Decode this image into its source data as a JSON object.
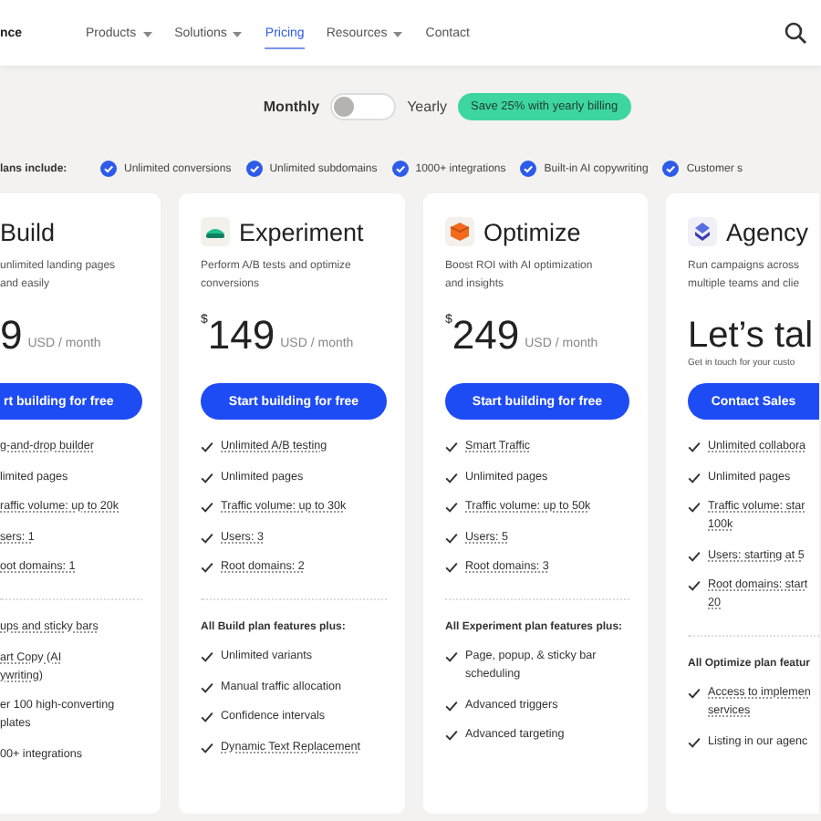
{
  "nav": {
    "logo": "nce",
    "items": [
      {
        "label": "Products",
        "dropdown": true,
        "selected": false
      },
      {
        "label": "Solutions",
        "dropdown": true,
        "selected": false
      },
      {
        "label": "Pricing",
        "dropdown": false,
        "selected": true
      },
      {
        "label": "Resources",
        "dropdown": true,
        "selected": false
      },
      {
        "label": "Contact",
        "dropdown": false,
        "selected": false
      }
    ]
  },
  "billing": {
    "monthly": "Monthly",
    "yearly": "Yearly",
    "yearly_on": false,
    "badge": "Save 25% with yearly billing"
  },
  "includes": {
    "label": "lans include:",
    "items": [
      "Unlimited conversions",
      "Unlimited subdomains",
      "1000+ integrations",
      "Built-in AI copywriting",
      "Customer s"
    ]
  },
  "plans": [
    {
      "clipped": true,
      "name": "Build",
      "description_lines": [
        "unlimited landing pages",
        "and easily"
      ],
      "price": "9",
      "period": "USD / month",
      "button": "rt building for free",
      "features": [
        {
          "lines": [
            "g-and-drop builder"
          ],
          "tooltip": true
        },
        {
          "lines": [
            "limited pages"
          ],
          "tooltip": false
        },
        {
          "lines": [
            "raffic volume: up to 20k"
          ],
          "tooltip": true
        },
        {
          "lines": [
            "sers: 1"
          ],
          "tooltip": true
        },
        {
          "lines": [
            "oot domains: 1"
          ],
          "tooltip": true
        }
      ],
      "extras": [
        {
          "lines": [
            "ups and sticky bars"
          ],
          "tooltip": true
        },
        {
          "lines": [
            "art Copy (AI",
            "ywriting)"
          ],
          "tooltip": true
        },
        {
          "lines": [
            "er 100 high-converting",
            "plates"
          ],
          "tooltip": false
        },
        {
          "lines": [
            "00+ integrations"
          ],
          "tooltip": false
        }
      ]
    },
    {
      "clipped": false,
      "name": "Experiment",
      "description_lines": [
        "Perform A/B tests and optimize",
        "conversions"
      ],
      "currency": "$",
      "price": "149",
      "period": "USD / month",
      "button": "Start building for free",
      "features": [
        {
          "lines": [
            "Unlimited A/B testing"
          ],
          "tooltip": true
        },
        {
          "lines": [
            "Unlimited pages"
          ],
          "tooltip": false
        },
        {
          "lines": [
            "Traffic volume: up to 30k"
          ],
          "tooltip": true
        },
        {
          "lines": [
            "Users: 3"
          ],
          "tooltip": true
        },
        {
          "lines": [
            "Root domains: 2"
          ],
          "tooltip": true
        }
      ],
      "extra_title": "All Build plan features plus:",
      "extras": [
        {
          "lines": [
            "Unlimited variants"
          ],
          "tooltip": false
        },
        {
          "lines": [
            "Manual traffic allocation"
          ],
          "tooltip": false
        },
        {
          "lines": [
            "Confidence intervals"
          ],
          "tooltip": false
        },
        {
          "lines": [
            "Dynamic Text Replacement"
          ],
          "tooltip": true
        }
      ]
    },
    {
      "clipped": false,
      "name": "Optimize",
      "description_lines": [
        "Boost ROI with AI optimization",
        "and insights"
      ],
      "currency": "$",
      "price": "249",
      "period": "USD / month",
      "button": "Start building for free",
      "features": [
        {
          "lines": [
            "Smart Traffic"
          ],
          "tooltip": true
        },
        {
          "lines": [
            "Unlimited pages"
          ],
          "tooltip": false
        },
        {
          "lines": [
            "Traffic volume: up to 50k"
          ],
          "tooltip": true
        },
        {
          "lines": [
            "Users: 5"
          ],
          "tooltip": true
        },
        {
          "lines": [
            "Root domains: 3"
          ],
          "tooltip": true
        }
      ],
      "extra_title": "All Experiment plan features plus:",
      "extras": [
        {
          "lines": [
            "Page, popup, & sticky bar",
            "scheduling"
          ],
          "tooltip": false
        },
        {
          "lines": [
            "Advanced triggers"
          ],
          "tooltip": false
        },
        {
          "lines": [
            "Advanced targeting"
          ],
          "tooltip": false
        }
      ]
    },
    {
      "clipped": false,
      "name": "Agency",
      "description_lines": [
        "Run campaigns across",
        "multiple teams and clie"
      ],
      "price": "Let’s tal",
      "note": "Get in touch for your custo",
      "button": "Contact Sales",
      "features": [
        {
          "lines": [
            "Unlimited collabora"
          ],
          "tooltip": true
        },
        {
          "lines": [
            "Unlimited pages"
          ],
          "tooltip": false
        },
        {
          "lines": [
            "Traffic volume: star",
            "100k"
          ],
          "tooltip": true
        },
        {
          "lines": [
            "Users: starting at 5"
          ],
          "tooltip": true
        },
        {
          "lines": [
            "Root domains: start",
            "20"
          ],
          "tooltip": true
        }
      ],
      "extra_title": "All Optimize plan featur",
      "extras": [
        {
          "lines": [
            "Access to implemen",
            "services"
          ],
          "tooltip": true
        },
        {
          "lines": [
            "Listing in our agenc"
          ],
          "tooltip": false
        }
      ]
    }
  ]
}
